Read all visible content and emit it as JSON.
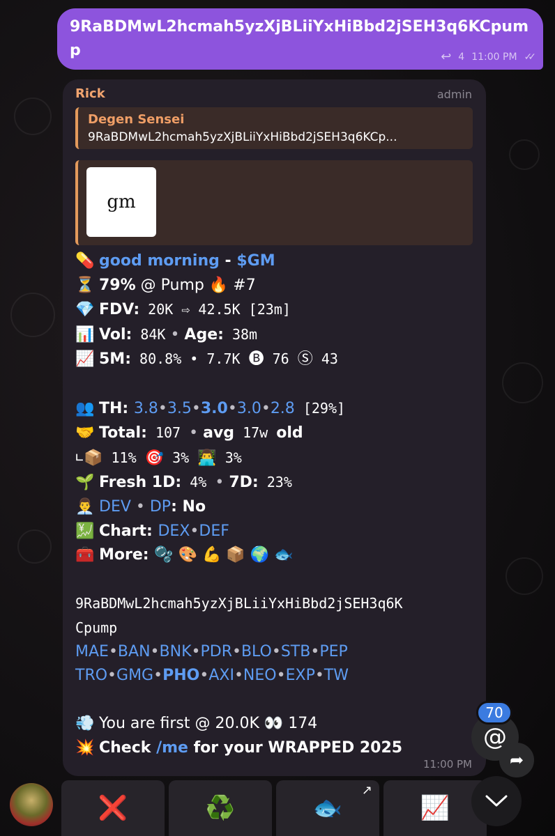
{
  "outgoing": {
    "text": "9RaBDMwL2hcmah5yzXjBLiiYxHiBbd2jSEH3q6KCpump",
    "reply_count": "4",
    "time": "11:00 PM",
    "ticks": "✓✓"
  },
  "card": {
    "sender": "Rick",
    "role": "admin",
    "quote_author": "Degen Sensei",
    "quote_text": "9RaBDMwL2hcmah5yzXjBLiiYxHiBbd2jSEH3q6KCp...",
    "preview_thumb": "gm",
    "time": "11:00 PM",
    "title": {
      "emoji": "💊",
      "name": "good morning",
      "sep": " - ",
      "ticker": "$GM"
    },
    "progress": {
      "emoji": "⏳",
      "pct": "79%",
      "rest": " @ Pump ",
      "fire": "🔥",
      "rank": " #7"
    },
    "fdv": {
      "emoji": "💎",
      "label": "FDV:",
      "value": " 20K ⇨ 42.5K [23m]"
    },
    "vol": {
      "emoji": "📊",
      "label": "Vol:",
      "value": " 84K",
      "age_label": "Age:",
      "age": " 38m"
    },
    "m5": {
      "emoji": "📈",
      "label": "5M:",
      "value": " 80.8% • 7.7K ",
      "b_icon": "🅑",
      "b_val": " 76 ",
      "s_icon": "Ⓢ",
      "s_val": " 43"
    },
    "th": {
      "emoji": "👥",
      "label": "TH: ",
      "v1": "3.8",
      "v2": "3.5",
      "v3": "3.0",
      "v4": "3.0",
      "v5": "2.8",
      "pct": " [29%]"
    },
    "total": {
      "emoji": "🤝",
      "label": "Total:",
      "value": " 107 ",
      "avg": "avg",
      "w": " 17w ",
      "old": "old"
    },
    "sub": {
      "arrow": "  ∟",
      "box": "📦",
      "v1": " 11% ",
      "target": "🎯",
      "v2": " 3% ",
      "worker": "👨‍💻",
      "v3": " 3%"
    },
    "fresh": {
      "emoji": "🌱",
      "label": "Fresh 1D:",
      "v1": " 4% ",
      "label2": "7D:",
      "v2": " 23%"
    },
    "dev": {
      "emoji": "👨‍💼",
      "dev": "DEV",
      "dp": "DP",
      "value": ": No"
    },
    "chart": {
      "emoji": "💹",
      "label": "Chart: ",
      "l1": "DEX",
      "l2": "DEF"
    },
    "more": {
      "emoji": "🧰",
      "label": "More: ",
      "icons": "🫧 🎨 💪 📦 🌍 🐟"
    },
    "address1": "9RaBDMwL2hcmah5yzXjBLiiYxHiBbd2jSEH3q6K",
    "address2": "Cpump",
    "links1": [
      "MAE",
      "BAN",
      "BNK",
      "PDR",
      "BLO",
      "STB",
      "PEP"
    ],
    "links2": [
      "TRO",
      "GMG",
      "PHO",
      "AXI",
      "NEO",
      "EXP",
      "TW"
    ],
    "first": {
      "emoji": "💨",
      "text": "You are first @ ",
      "val": "20.0K",
      "eyes": " 👀",
      "count": " 174"
    },
    "check": {
      "emoji": "💥",
      "pre": "Check ",
      "cmd": "/me",
      "post": " for your WRAPPED 2025"
    }
  },
  "mention_count": "70",
  "keyboard": {
    "b1": "❌",
    "b2": "♻️",
    "b3": "🐟",
    "b4": "📈"
  }
}
